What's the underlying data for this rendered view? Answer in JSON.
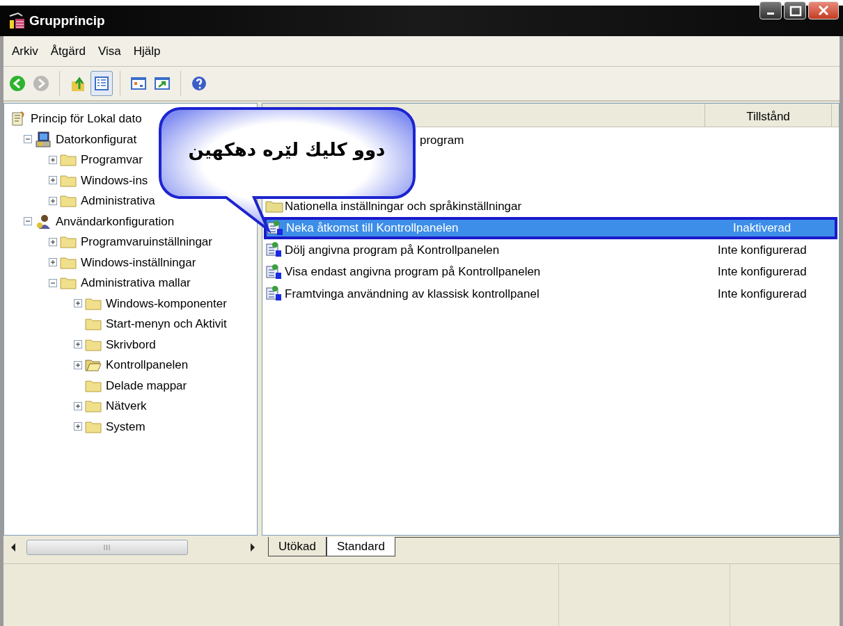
{
  "window": {
    "title": "Grupprincip"
  },
  "menu": [
    "Arkiv",
    "Åtgärd",
    "Visa",
    "Hjälp"
  ],
  "toolbar": [
    {
      "kind": "back",
      "disabled": false,
      "pressed": false
    },
    {
      "kind": "forward",
      "disabled": true,
      "pressed": false
    },
    {
      "kind": "up",
      "disabled": false,
      "pressed": false
    },
    {
      "kind": "tree",
      "disabled": false,
      "pressed": true
    },
    {
      "kind": "window",
      "disabled": false,
      "pressed": false
    },
    {
      "kind": "export",
      "disabled": false,
      "pressed": false
    },
    {
      "kind": "help",
      "disabled": false,
      "pressed": false
    }
  ],
  "tree": [
    {
      "label": "Princip för Lokal dato",
      "kind": "policy",
      "children": [
        {
          "label": "Datorkonfigurat",
          "kind": "computer",
          "expanded": true,
          "children": [
            {
              "label": "Programvar",
              "kind": "folder",
              "expanded": false
            },
            {
              "label": "Windows-ins",
              "kind": "folder",
              "expanded": false
            },
            {
              "label": "Administrativa",
              "kind": "folder",
              "expanded": false
            }
          ]
        },
        {
          "label": "Användarkonfiguration",
          "kind": "user",
          "expanded": true,
          "children": [
            {
              "label": "Programvaruinställningar",
              "kind": "folder",
              "expanded": false
            },
            {
              "label": "Windows-inställningar",
              "kind": "folder",
              "expanded": false
            },
            {
              "label": "Administrativa mallar",
              "kind": "folder",
              "expanded": true,
              "children": [
                {
                  "label": "Windows-komponenter",
                  "kind": "folder",
                  "expanded": false
                },
                {
                  "label": "Start-menyn och Aktivit",
                  "kind": "folder"
                },
                {
                  "label": "Skrivbord",
                  "kind": "folder",
                  "expanded": false
                },
                {
                  "label": "Kontrollpanelen",
                  "kind": "open_folder",
                  "expanded": false
                },
                {
                  "label": "Delade mappar",
                  "kind": "folder"
                },
                {
                  "label": "Nätverk",
                  "kind": "folder",
                  "expanded": false
                },
                {
                  "label": "System",
                  "kind": "folder",
                  "expanded": false
                }
              ]
            }
          ]
        }
      ]
    }
  ],
  "list": {
    "columns": [
      {
        "label": "Tillstånd"
      }
    ],
    "rows": [
      {
        "kind": "partial",
        "name": "program",
        "selected": false
      },
      {
        "kind": "folder",
        "name": "Nationella inställningar och språkinställningar",
        "selected": false
      },
      {
        "kind": "setting",
        "name": "Neka åtkomst till Kontrollpanelen",
        "state": "Inaktiverad",
        "selected": true
      },
      {
        "kind": "setting",
        "name": "Dölj angivna program på Kontrollpanelen",
        "state": "Inte konfigurerad",
        "selected": false
      },
      {
        "kind": "setting",
        "name": "Visa endast angivna program på Kontrollpanelen",
        "state": "Inte konfigurerad",
        "selected": false
      },
      {
        "kind": "setting",
        "name": "Framtvinga användning av klassisk kontrollpanel",
        "state": "Inte konfigurerad",
        "selected": false
      }
    ]
  },
  "callout": {
    "text": "دوو كليك لێره دهكهين"
  },
  "tabs": [
    {
      "label": "Utökad",
      "selected": false
    },
    {
      "label": "Standard",
      "selected": true
    }
  ]
}
